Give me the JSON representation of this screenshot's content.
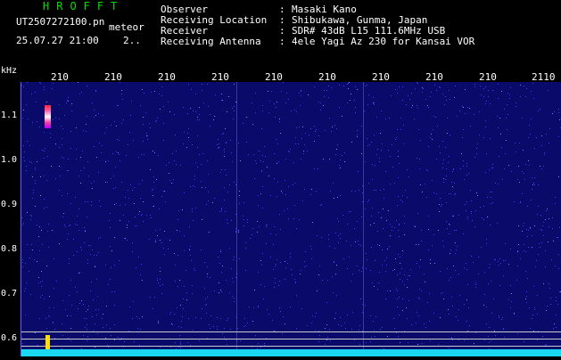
{
  "brand": "HROFFT",
  "file_name": "UT2507272100.pn",
  "mode": "meteor",
  "date_time": "25.07.27 21:00",
  "date_value": "2..",
  "info": [
    {
      "key": "Observer",
      "value": "Masaki Kano"
    },
    {
      "key": "Receiving Location",
      "value": "Shibukawa, Gunma, Japan"
    },
    {
      "key": "Receiver",
      "value": "SDR# 43dB L15 111.6MHz USB"
    },
    {
      "key": "Receiving Antenna",
      "value": "4ele Yagi Az 230 for Kansai VOR"
    }
  ],
  "separator": ":",
  "spectrogram": {
    "unit": "kHz",
    "x_ticks": [
      "210",
      "210",
      "210",
      "210",
      "210",
      "210",
      "210",
      "210",
      "210",
      "2110"
    ],
    "y_ticks": [
      "1.1",
      "1.0",
      "0.9",
      "0.8",
      "0.7",
      "0.6"
    ],
    "colors": {
      "background": "#0a0a6a",
      "noise": "#3d3dff",
      "trace": "#19d8f0",
      "echo": "#ff3aa0",
      "spike": "#ffe000",
      "brand": "#00e000"
    }
  }
}
